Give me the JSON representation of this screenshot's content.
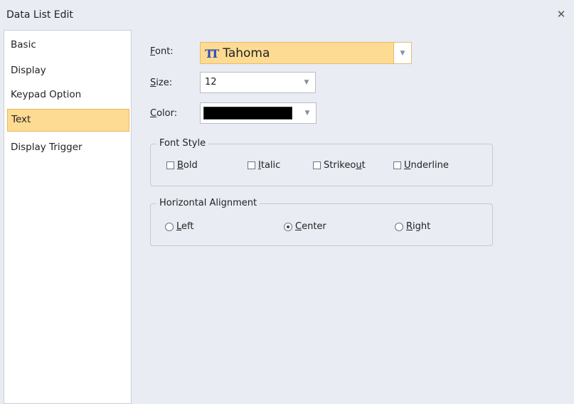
{
  "window": {
    "title": "Data List Edit",
    "close_icon": "close-icon"
  },
  "nav": {
    "items": [
      {
        "label": "Basic",
        "selected": false
      },
      {
        "label": "Display",
        "selected": false
      },
      {
        "label": "Keypad Option",
        "selected": false
      },
      {
        "label": "Text",
        "selected": true
      },
      {
        "label": "Display Trigger",
        "selected": false
      }
    ]
  },
  "text": {
    "font": {
      "label_key": "F",
      "label_rest": "ont:",
      "value": "Tahoma",
      "icon": "truetype-font-icon"
    },
    "size": {
      "label_key": "S",
      "label_rest": "ize:",
      "value": "12"
    },
    "color": {
      "label_key": "C",
      "label_rest": "olor:",
      "value": "#000000"
    },
    "font_style": {
      "title": "Font Style",
      "options": [
        {
          "key": "B",
          "rest": "old",
          "checked": false
        },
        {
          "key": "I",
          "rest": "talic",
          "checked": false
        },
        {
          "pre": "Strikeo",
          "key": "u",
          "rest": "t",
          "checked": false
        },
        {
          "key": "U",
          "rest": "nderline",
          "checked": false
        }
      ]
    },
    "alignment": {
      "title": "Horizontal Alignment",
      "options": [
        {
          "key": "L",
          "rest": "eft",
          "checked": false
        },
        {
          "key": "C",
          "rest": "enter",
          "checked": true
        },
        {
          "key": "R",
          "rest": "ight",
          "checked": false
        }
      ]
    }
  },
  "colors": {
    "selected_bg": "#fddb92",
    "window_bg": "#e9ecf3"
  }
}
